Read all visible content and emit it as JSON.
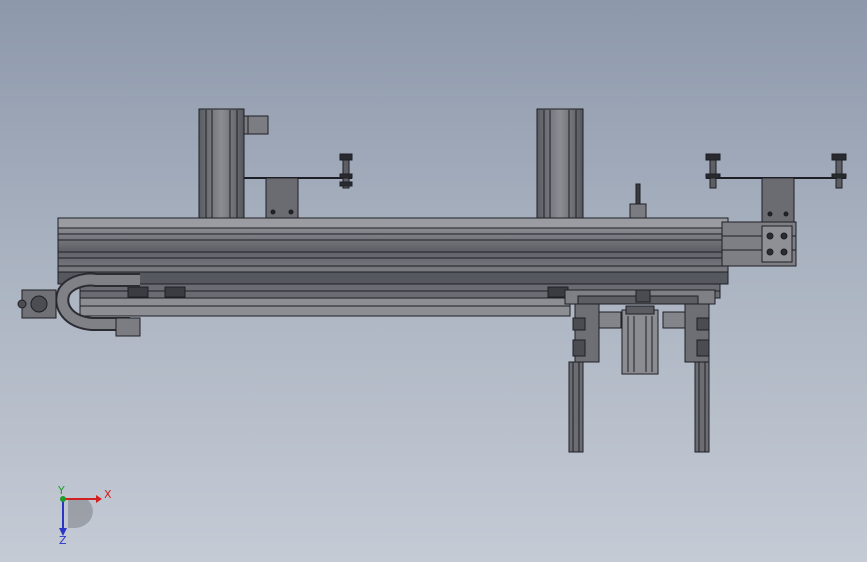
{
  "viewport": {
    "background_top": "#8d98ab",
    "background_bottom": "#c5cbd5"
  },
  "triad": {
    "x_label": "X",
    "y_label": "Y",
    "z_label": "Z",
    "x_color": "#d21f1f",
    "y_color": "#1f9d2b",
    "z_color": "#2b36c4"
  },
  "model": {
    "body_color": "#6e7077",
    "edge_color": "#1e1f24",
    "light_color": "#9fa1a7",
    "dark_color": "#4a4c52"
  }
}
